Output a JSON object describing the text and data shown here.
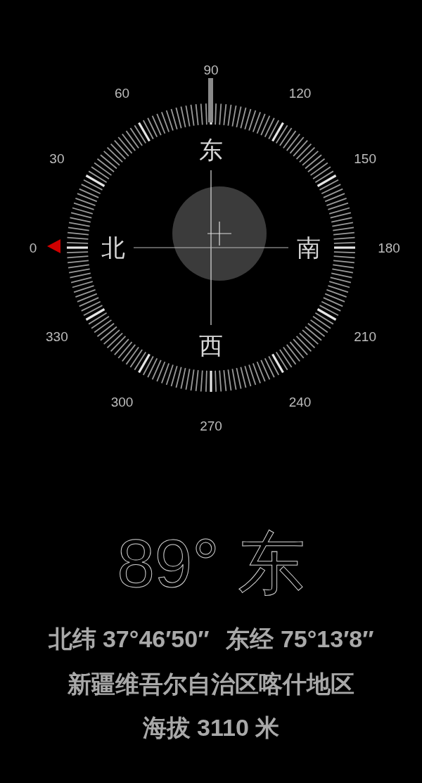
{
  "dial": {
    "degree_labels": [
      {
        "label": "0"
      },
      {
        "label": "30"
      },
      {
        "label": "60"
      },
      {
        "label": "90"
      },
      {
        "label": "120"
      },
      {
        "label": "150"
      },
      {
        "label": "180"
      },
      {
        "label": "210"
      },
      {
        "label": "240"
      },
      {
        "label": "270"
      },
      {
        "label": "300"
      },
      {
        "label": "330"
      }
    ],
    "cardinals": [
      {
        "label": "北"
      },
      {
        "label": "东"
      },
      {
        "label": "南"
      },
      {
        "label": "西"
      }
    ]
  },
  "readout": {
    "heading": "89°",
    "direction": "东",
    "latitude": "北纬 37°46′50″",
    "longitude": "东经 75°13′8″",
    "location": "新疆维吾尔自治区喀什地区",
    "altitude": "海拔 3110 米"
  }
}
